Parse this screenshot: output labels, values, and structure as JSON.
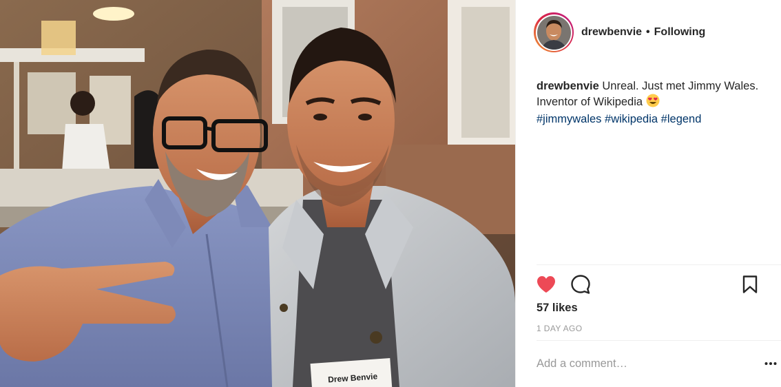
{
  "post": {
    "username": "drewbenvie",
    "separator": "•",
    "follow_status": "Following",
    "caption": {
      "username": "drewbenvie",
      "text": "Unreal. Just met Jimmy Wales. Inventor of Wikipedia",
      "emoji": "heart-eyes-emoji",
      "hashtags": [
        "#jimmywales",
        "#wikipedia",
        "#legend"
      ]
    },
    "likes": "57 likes",
    "time": "1 DAY AGO",
    "comment_placeholder": "Add a comment…",
    "name_tag": "Drew Benvie",
    "liked": true
  },
  "icons": {
    "like": "heart-icon",
    "comment": "comment-icon",
    "save": "bookmark-icon",
    "more": "more-options-icon"
  },
  "colors": {
    "heart": "#ed4956",
    "hashtag": "#003569",
    "muted": "#999999",
    "text": "#262626",
    "divider": "#efefef"
  }
}
